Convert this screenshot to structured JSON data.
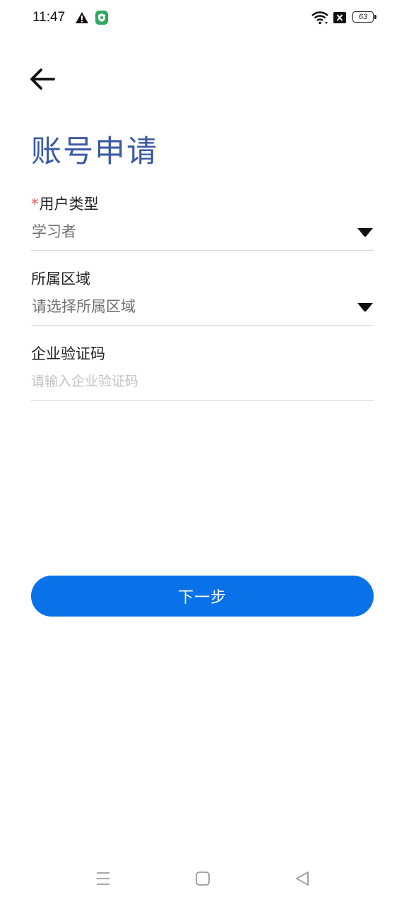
{
  "status_bar": {
    "time": "11:47",
    "battery_level": "63",
    "icons": [
      "warning-icon",
      "shield-icon",
      "wifi-icon",
      "sim-off-icon",
      "battery-icon"
    ]
  },
  "header": {
    "back_icon": "arrow-left-icon",
    "title": "账号申请"
  },
  "form": {
    "user_type": {
      "required_mark": "*",
      "label": "用户类型",
      "value": "学习者"
    },
    "region": {
      "label": "所属区域",
      "placeholder": "请选择所属区域"
    },
    "enterprise_code": {
      "label": "企业验证码",
      "placeholder": "请输入企业验证码"
    }
  },
  "actions": {
    "next_label": "下一步"
  },
  "colors": {
    "title": "#3a59a6",
    "primary_button": "#0a72e8",
    "required": "#e5564b"
  },
  "nav_bar": {
    "icons": [
      "menu-icon",
      "home-square-icon",
      "back-triangle-icon"
    ]
  }
}
